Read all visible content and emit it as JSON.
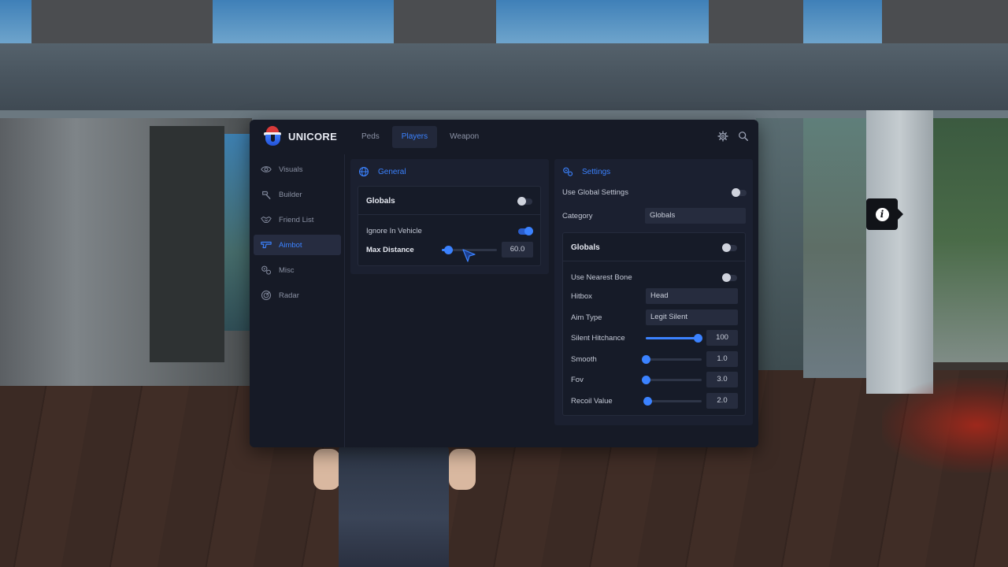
{
  "app": {
    "brand": "UNICORE",
    "accent_color": "#3b82ff",
    "logo_icon": "santa-hat-logo-icon"
  },
  "header": {
    "tabs": [
      {
        "label": "Peds",
        "active": false
      },
      {
        "label": "Players",
        "active": true
      },
      {
        "label": "Weapon",
        "active": false
      }
    ],
    "icons": [
      "gear-icon",
      "search-icon"
    ]
  },
  "sidebar": {
    "items": [
      {
        "label": "Visuals",
        "icon": "eye-icon",
        "active": false
      },
      {
        "label": "Builder",
        "icon": "hammer-icon",
        "active": false
      },
      {
        "label": "Friend List",
        "icon": "handshake-icon",
        "active": false
      },
      {
        "label": "Aimbot",
        "icon": "gun-icon",
        "active": true
      },
      {
        "label": "Misc",
        "icon": "gears-icon",
        "active": false
      },
      {
        "label": "Radar",
        "icon": "radar-icon",
        "active": false
      }
    ]
  },
  "general": {
    "title": "General",
    "icon": "globe-icon",
    "globals": {
      "title": "Globals",
      "enabled": false,
      "ignore_in_vehicle": {
        "label": "Ignore In Vehicle",
        "enabled": true
      },
      "max_distance": {
        "label": "Max Distance",
        "value": "60.0",
        "fraction": 0.12
      }
    }
  },
  "settings": {
    "title": "Settings",
    "icon": "gears-icon",
    "use_global_settings": {
      "label": "Use Global Settings",
      "enabled": false
    },
    "category": {
      "label": "Category",
      "value": "Globals"
    },
    "globals": {
      "title": "Globals",
      "enabled": false,
      "use_nearest_bone": {
        "label": "Use Nearest Bone",
        "enabled": false
      },
      "hitbox": {
        "label": "Hitbox",
        "value": "Head"
      },
      "aim_type": {
        "label": "Aim Type",
        "value": "Legit Silent"
      },
      "silent_hitchance": {
        "label": "Silent Hitchance",
        "value": "100",
        "fraction": 1.0
      },
      "smooth": {
        "label": "Smooth",
        "value": "1.0",
        "fraction": 0.0
      },
      "fov": {
        "label": "Fov",
        "value": "3.0",
        "fraction": 0.0
      },
      "recoil_value": {
        "label": "Recoil Value",
        "value": "2.0",
        "fraction": 0.03
      }
    }
  },
  "tooltip": {
    "icon": "info-icon"
  }
}
